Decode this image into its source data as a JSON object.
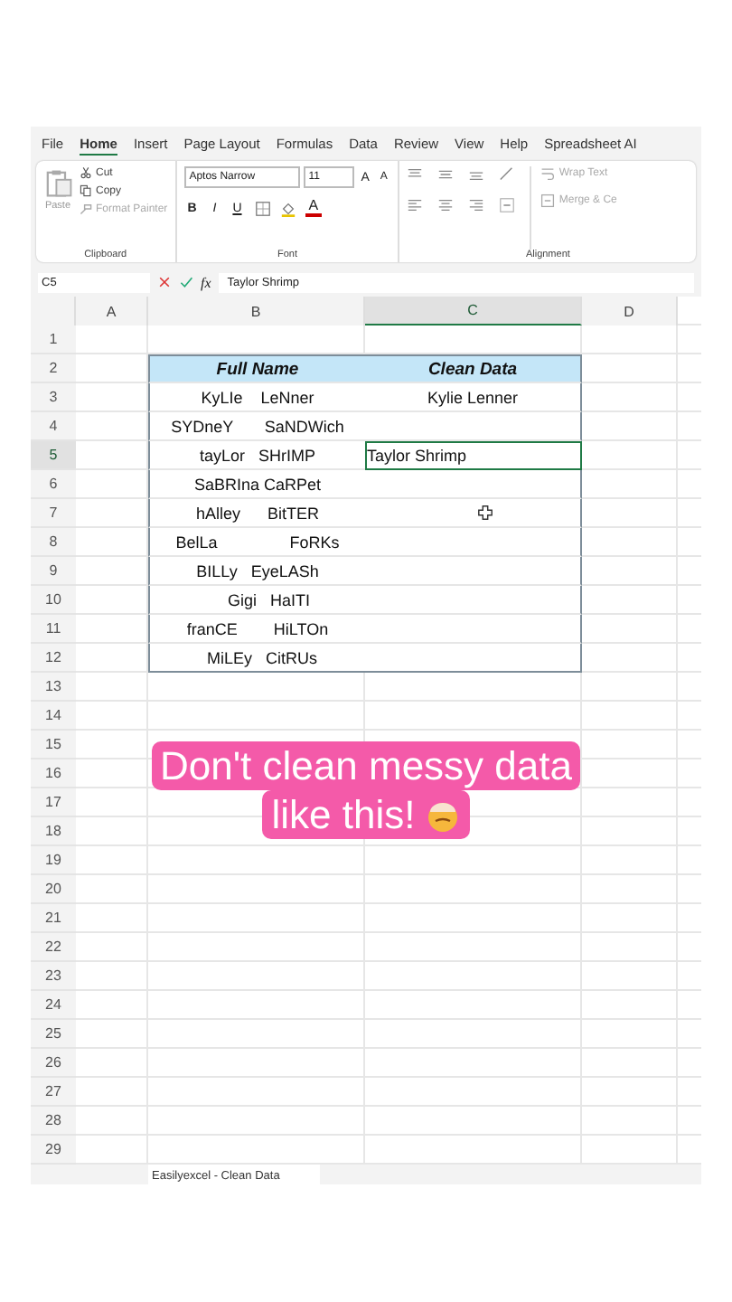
{
  "menu_tabs": [
    {
      "label": "File",
      "selected": false
    },
    {
      "label": "Home",
      "selected": true
    },
    {
      "label": "Insert",
      "selected": false
    },
    {
      "label": "Page Layout",
      "selected": false
    },
    {
      "label": "Formulas",
      "selected": false
    },
    {
      "label": "Data",
      "selected": false
    },
    {
      "label": "Review",
      "selected": false
    },
    {
      "label": "View",
      "selected": false
    },
    {
      "label": "Help",
      "selected": false
    },
    {
      "label": "Spreadsheet AI",
      "selected": false
    }
  ],
  "clipboard": {
    "paste": "Paste",
    "cut": "Cut",
    "copy": "Copy",
    "format_painter": "Format Painter",
    "group_label": "Clipboard"
  },
  "font": {
    "name": "Aptos Narrow",
    "size": "11",
    "grow": "A",
    "shrink": "A",
    "bold": "B",
    "italic": "I",
    "underline": "U",
    "font_color": "A",
    "group_label": "Font"
  },
  "alignment": {
    "wrap_text": "Wrap Text",
    "merge": "Merge & Ce",
    "group_label": "Alignment"
  },
  "formula_bar": {
    "name_box": "C5",
    "fx": "fx",
    "value": "Taylor Shrimp"
  },
  "columns": [
    {
      "label": "A",
      "selected": false
    },
    {
      "label": "B",
      "selected": false
    },
    {
      "label": "C",
      "selected": true
    },
    {
      "label": "D",
      "selected": false
    }
  ],
  "rows": [
    {
      "number": "1",
      "selected": false
    },
    {
      "number": "2",
      "selected": false,
      "kind": "header",
      "b": "Full Name",
      "c": "Clean Data"
    },
    {
      "number": "3",
      "selected": false,
      "kind": "data",
      "b": "KyLIe    LeNner",
      "c": "Kylie Lenner"
    },
    {
      "number": "4",
      "selected": false,
      "kind": "data",
      "b": "SYDneY       SaNDWich"
    },
    {
      "number": "5",
      "selected": true,
      "kind": "data",
      "b": "tayLor   SHrIMP",
      "c": "Taylor Shrimp"
    },
    {
      "number": "6",
      "selected": false,
      "kind": "data",
      "b": "SaBRIna CaRPet"
    },
    {
      "number": "7",
      "selected": false,
      "kind": "data",
      "b": "hAlley      BitTER"
    },
    {
      "number": "8",
      "selected": false,
      "kind": "data",
      "b": "BelLa                FoRKs"
    },
    {
      "number": "9",
      "selected": false,
      "kind": "data",
      "b": "BILLy   EyeLASh"
    },
    {
      "number": "10",
      "selected": false,
      "kind": "data",
      "b": "     Gigi   HaITI"
    },
    {
      "number": "11",
      "selected": false,
      "kind": "data",
      "b": "franCE        HiLTOn"
    },
    {
      "number": "12",
      "selected": false,
      "kind": "data",
      "b": "  MiLEy   CitRUs"
    },
    {
      "number": "13",
      "selected": false
    },
    {
      "number": "14",
      "selected": false
    },
    {
      "number": "15",
      "selected": false
    },
    {
      "number": "16",
      "selected": false
    },
    {
      "number": "17",
      "selected": false
    },
    {
      "number": "18",
      "selected": false
    },
    {
      "number": "19",
      "selected": false
    },
    {
      "number": "20",
      "selected": false
    },
    {
      "number": "21",
      "selected": false
    },
    {
      "number": "22",
      "selected": false
    },
    {
      "number": "23",
      "selected": false
    },
    {
      "number": "24",
      "selected": false
    },
    {
      "number": "25",
      "selected": false
    },
    {
      "number": "26",
      "selected": false
    },
    {
      "number": "27",
      "selected": false
    },
    {
      "number": "28",
      "selected": false
    },
    {
      "number": "29",
      "selected": false
    }
  ],
  "sheet_tab": {
    "label": "Easilyexcel - Clean Data",
    "selected": true
  },
  "caption": {
    "lines": [
      "Don't clean messy data",
      "like this!"
    ]
  }
}
